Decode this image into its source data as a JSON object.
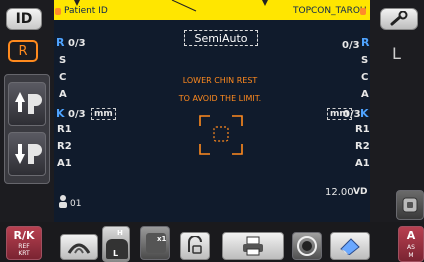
{
  "header": {
    "patient_id_label": "Patient ID",
    "device_name": "TOPCON_TAROU"
  },
  "mode": {
    "label": "SemiAuto"
  },
  "left_eye": {
    "r_label": "R",
    "r_count": "0/3",
    "s_label": "S",
    "c_label": "C",
    "a_label": "A",
    "k_label": "K",
    "k_count": "0/3",
    "mm_label": "mm",
    "r1_label": "R1",
    "r2_label": "R2",
    "a1_label": "A1"
  },
  "right_eye": {
    "r_label": "R",
    "r_count": "0/3",
    "s_label": "S",
    "c_label": "C",
    "a_label": "A",
    "k_label": "K",
    "k_count": "0/3",
    "mm_label": "mm",
    "r1_label": "R1",
    "r2_label": "R2",
    "a1_label": "A1"
  },
  "message": {
    "line1": "LOWER CHIN REST",
    "line2": "TO AVOID THE LIMIT."
  },
  "vd": {
    "value": "12.00",
    "label": "VD"
  },
  "patient_number": "01",
  "left_panel": {
    "id_button": "ID",
    "r_button": "R"
  },
  "right_panel": {
    "l_label": "L"
  },
  "bottom": {
    "rk_title": "R/K",
    "rk_sub1": "REF",
    "rk_sub2": "KRT",
    "h_label": "H",
    "l_label": "L",
    "x1_label": "x1",
    "a_label": "A",
    "as_label": "AS",
    "m_label": "M"
  },
  "colors": {
    "accent_yellow": "#ffe600",
    "accent_blue": "#4ea3ff",
    "accent_orange": "#ff8a1e",
    "panel_bg": "#101b2c"
  }
}
